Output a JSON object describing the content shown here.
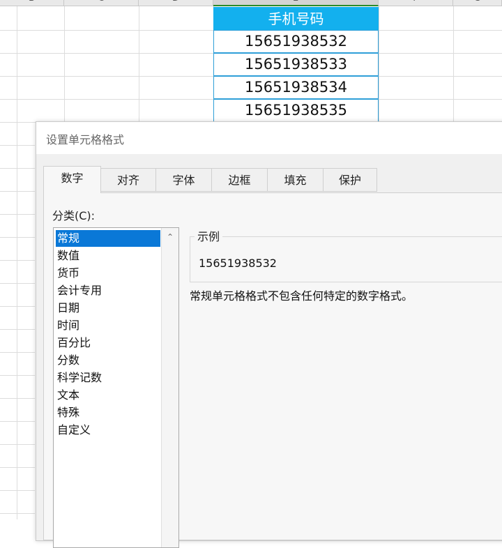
{
  "sheet": {
    "column_headers": [
      "B",
      "C",
      "D",
      "E",
      "F",
      "G"
    ],
    "header_cell": "手机号码",
    "phone_numbers": [
      "15651938532",
      "15651938533",
      "15651938534",
      "15651938535"
    ],
    "accent_color": "#13b0ee"
  },
  "dialog": {
    "title": "设置单元格格式",
    "tabs": [
      "数字",
      "对齐",
      "字体",
      "边框",
      "填充",
      "保护"
    ],
    "active_tab": "数字",
    "category_label": "分类(C):",
    "categories": [
      "常规",
      "数值",
      "货币",
      "会计专用",
      "日期",
      "时间",
      "百分比",
      "分数",
      "科学记数",
      "文本",
      "特殊",
      "自定义"
    ],
    "selected_category": "常规",
    "selection_color": "#0a78d7",
    "sample_label": "示例",
    "sample_value": "15651938532",
    "description": "常规单元格格式不包含任何特定的数字格式。"
  }
}
